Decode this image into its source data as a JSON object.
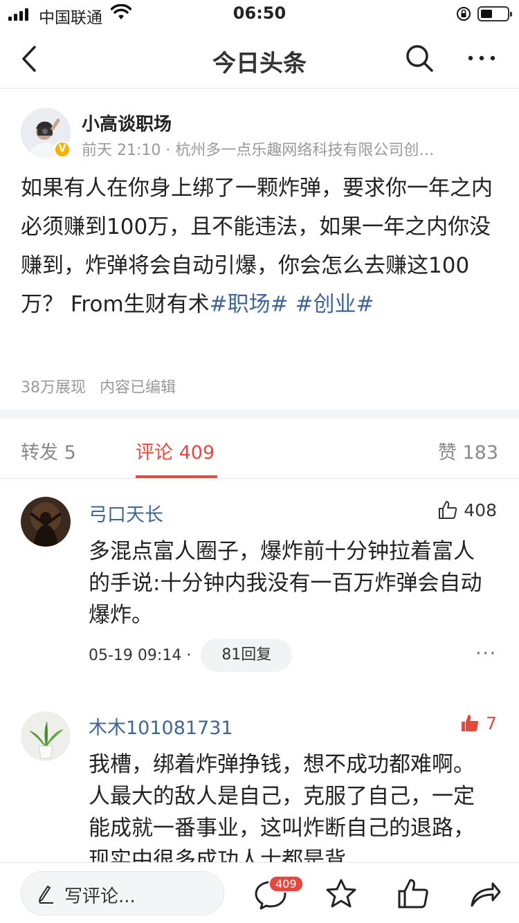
{
  "status_bar": {
    "carrier": "中国联通",
    "time": "06:50"
  },
  "nav": {
    "title": "今日头条"
  },
  "post": {
    "author_name": "小高谈职场",
    "author_meta": "前天 21:10 · 杭州多一点乐趣网络科技有限公司创…",
    "verified_mark": "V",
    "body_text": "如果有人在你身上绑了一颗炸弹，要求你一年之内必须赚到100万，且不能违法，如果一年之内你没赚到，炸弹将会自动引爆，你会怎么去赚这100万？ From生财有术",
    "tag_1": "#职场#",
    "tag_2": "#创业#",
    "views": "38万展现",
    "edited": "内容已编辑"
  },
  "tabs": {
    "forward": "转发 5",
    "comments": "评论 409",
    "likes": "赞 183"
  },
  "comments": [
    {
      "name": "弓口天长",
      "likes": "408",
      "text": "多混点富人圈子，爆炸前十分钟拉着富人的手说:十分钟内我没有一百万炸弹会自动爆炸。",
      "time": "05-19 09:14 ·",
      "replies": "81回复",
      "more": "···"
    },
    {
      "name": "木木101081731",
      "likes": "7",
      "text": "我槽，绑着炸弹挣钱，想不成功都难啊。人最大的敌人是自己，克服了自己，一定能成就一番事业，这叫炸断自己的退路，现实中很多成功人士都是背"
    }
  ],
  "bottom_bar": {
    "write_placeholder": "写评论...",
    "comment_badge": "409"
  },
  "colors": {
    "accent_red": "#e5483f",
    "link_blue": "#406599"
  }
}
